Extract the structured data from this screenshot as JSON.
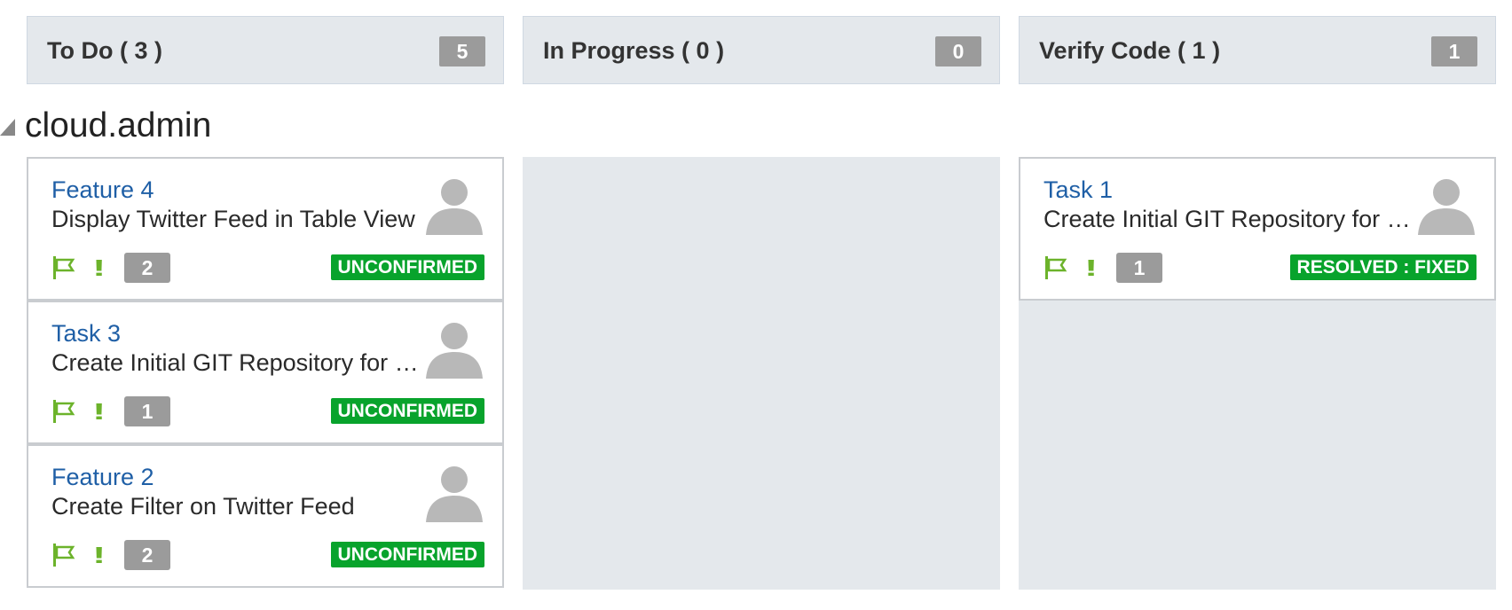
{
  "columns": [
    {
      "title": "To Do ( 3 )",
      "count": "5"
    },
    {
      "title": "In Progress ( 0 )",
      "count": "0"
    },
    {
      "title": "Verify Code ( 1 )",
      "count": "1"
    }
  ],
  "group": {
    "name": "cloud.admin",
    "toggle_icon": "collapse-triangle-icon"
  },
  "todo_cards": [
    {
      "title": "Feature 4",
      "desc": "Display Twitter Feed in Table View",
      "count": "2",
      "status": "UNCONFIRMED"
    },
    {
      "title": "Task 3",
      "desc": "Create Initial GIT Repository for Mobile App",
      "count": "1",
      "status": "UNCONFIRMED"
    },
    {
      "title": "Feature 2",
      "desc": "Create Filter on Twitter Feed",
      "count": "2",
      "status": "UNCONFIRMED"
    }
  ],
  "verify_cards": [
    {
      "title": "Task 1",
      "desc": "Create Initial GIT Repository for Web App",
      "count": "1",
      "status": "RESOLVED : FIXED"
    }
  ],
  "icons": {
    "avatar": "user-avatar-icon",
    "flag": "flag-icon",
    "priority": "priority-icon"
  },
  "priority_glyph": "!!",
  "colors": {
    "link": "#1f5fa6",
    "status_green": "#08a32c",
    "priority_green": "#6cb32b",
    "lane_bg": "#e4e8ec"
  }
}
